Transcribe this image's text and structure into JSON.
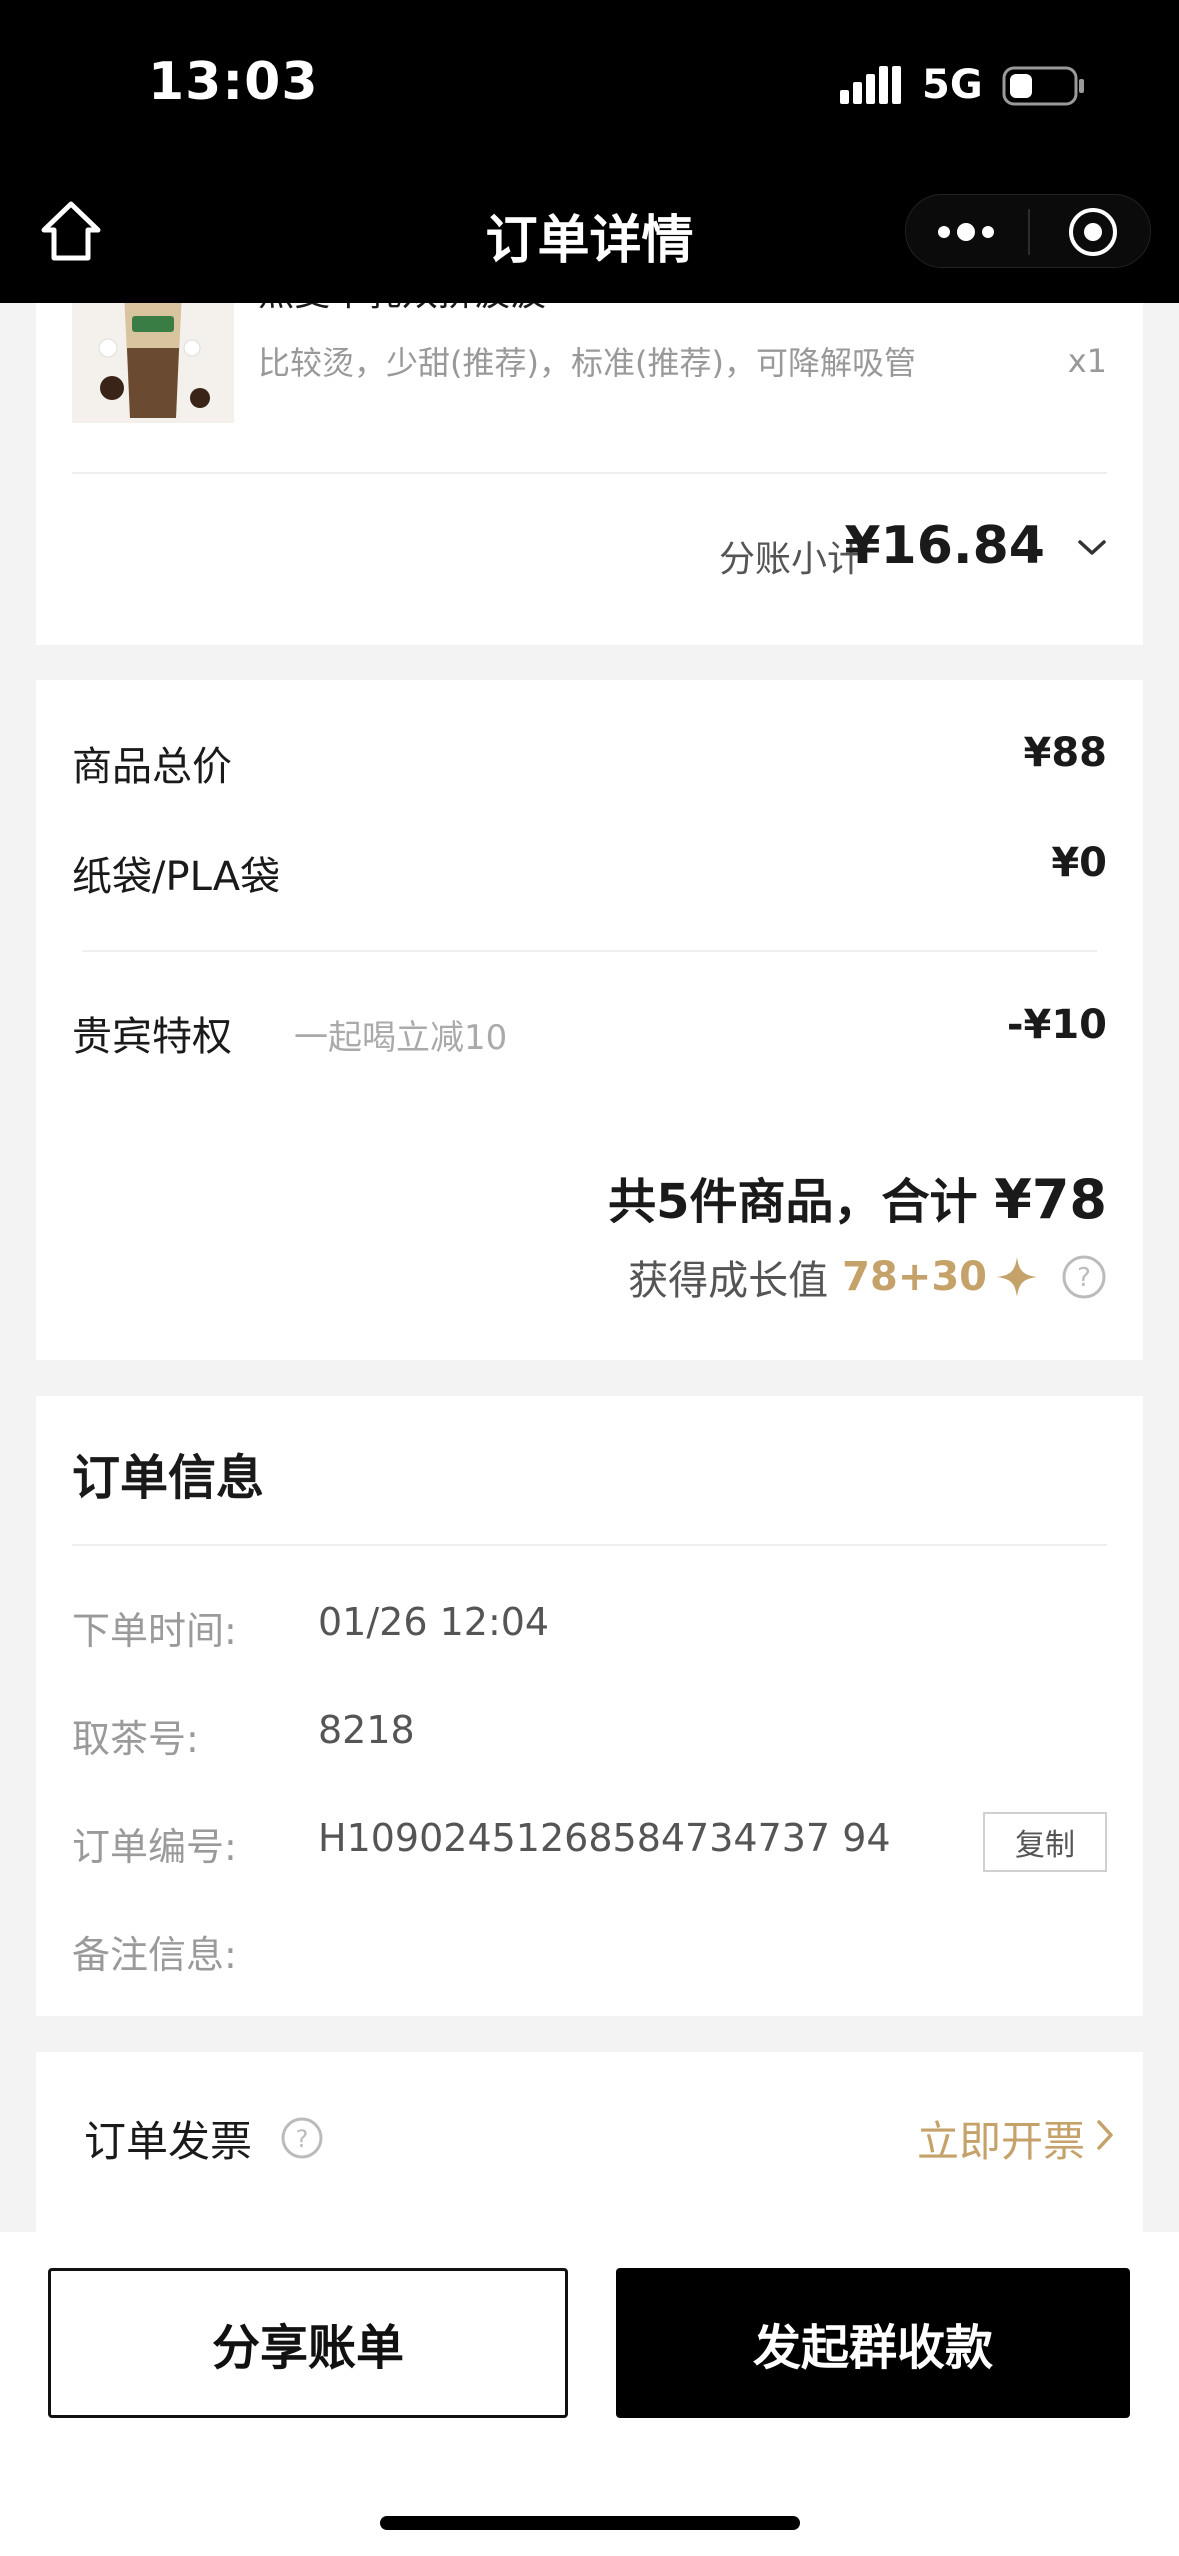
{
  "status_bar": {
    "time": "13:03",
    "network": "5G"
  },
  "nav": {
    "title": "订单详情"
  },
  "product": {
    "name_clipped": "燕麦牛乳双拼波波",
    "specs": "比较烫，少甜(推荐)，标准(推荐)，可降解吸管",
    "qty": "x1",
    "subtotal_label": "分账小计",
    "subtotal_value": "¥16.84"
  },
  "price": {
    "goods_total_label": "商品总价",
    "goods_total_value": "¥88",
    "bag_label": "纸袋/PLA袋",
    "bag_value": "¥0",
    "vip_label": "贵宾特权",
    "vip_note": "一起喝立减10",
    "vip_value": "-¥10",
    "total_prefix": "共5件商品，合计",
    "total_amount": "¥78",
    "growth_label": "获得成长值",
    "growth_points": "78+30"
  },
  "order_info": {
    "title": "订单信息",
    "time_label": "下单时间:",
    "time_value": "01/26 12:04",
    "pickup_label": "取茶号:",
    "pickup_value": "8218",
    "order_no_label": "订单编号:",
    "order_no_value": "H10902451268584734737 94",
    "copy_label": "复制",
    "remark_label": "备注信息:"
  },
  "invoice": {
    "label": "订单发票",
    "action": "立即开票"
  },
  "actions": {
    "share_label": "分享账单",
    "collect_label": "发起群收款"
  },
  "colors": {
    "accent_gold": "#c5a26a",
    "primary": "#000000"
  }
}
